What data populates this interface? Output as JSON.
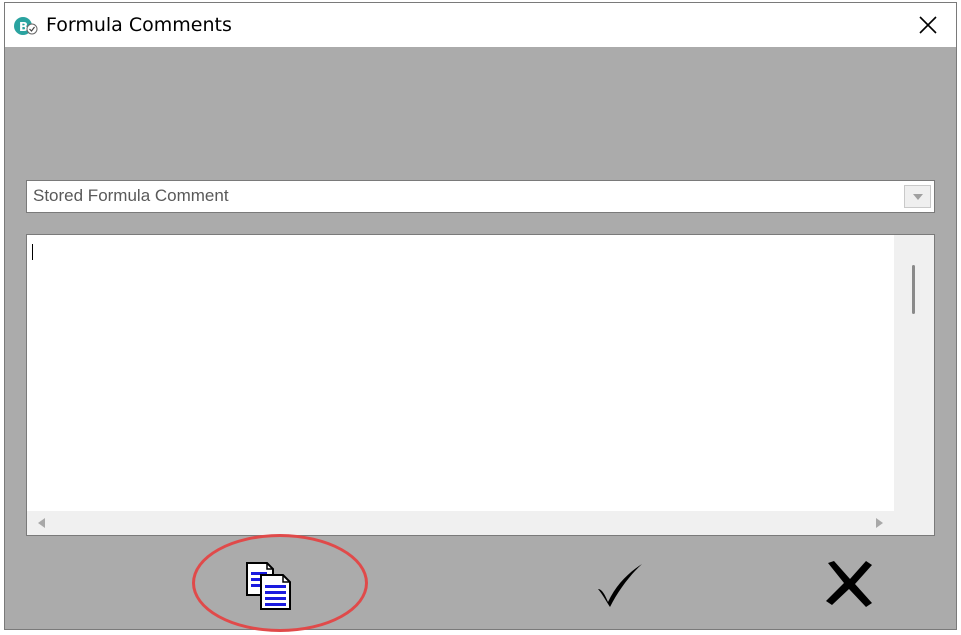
{
  "window": {
    "title": "Formula Comments",
    "app_icon": "app-b-icon",
    "close_icon": "close-icon"
  },
  "combo": {
    "value": "Stored Formula Comment",
    "arrow_icon": "chevron-down-icon"
  },
  "memo": {
    "text": ""
  },
  "buttons": {
    "copy_icon": "copy-icon",
    "ok_icon": "checkmark-icon",
    "cancel_icon": "close-icon"
  },
  "colors": {
    "dialog_bg": "#ababab",
    "annotation": "#e04a4a",
    "app_icon": "#2aa3a0"
  }
}
